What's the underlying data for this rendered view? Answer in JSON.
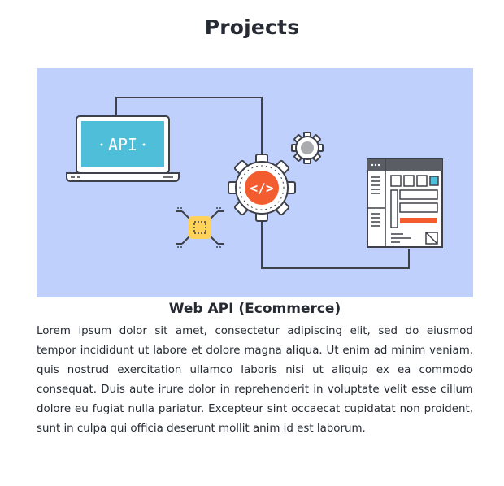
{
  "page": {
    "title": "Projects"
  },
  "project": {
    "image_label": "API",
    "code_symbol": "</>",
    "title": "Web API (Ecommerce)",
    "description": "Lorem ipsum dolor sit amet, consectetur adipiscing elit, sed do eiusmod tempor incididunt ut labore et dolore magna aliqua. Ut enim ad minim veniam, quis nostrud exercitation ullamco laboris nisi ut aliquip ex ea commodo consequat. Duis aute irure dolor in reprehenderit in voluptate velit esse cillum dolore eu fugiat nulla pariatur. Excepteur sint occaecat cupidatat non proident, sunt in culpa qui officia deserunt mollit anim id est laborum."
  },
  "colors": {
    "hero_background": "#c0d0fc",
    "screen": "#4fbfd9",
    "gear_center": "#f25c2f",
    "chip": "#ffd35a",
    "outline": "#3e4149"
  }
}
